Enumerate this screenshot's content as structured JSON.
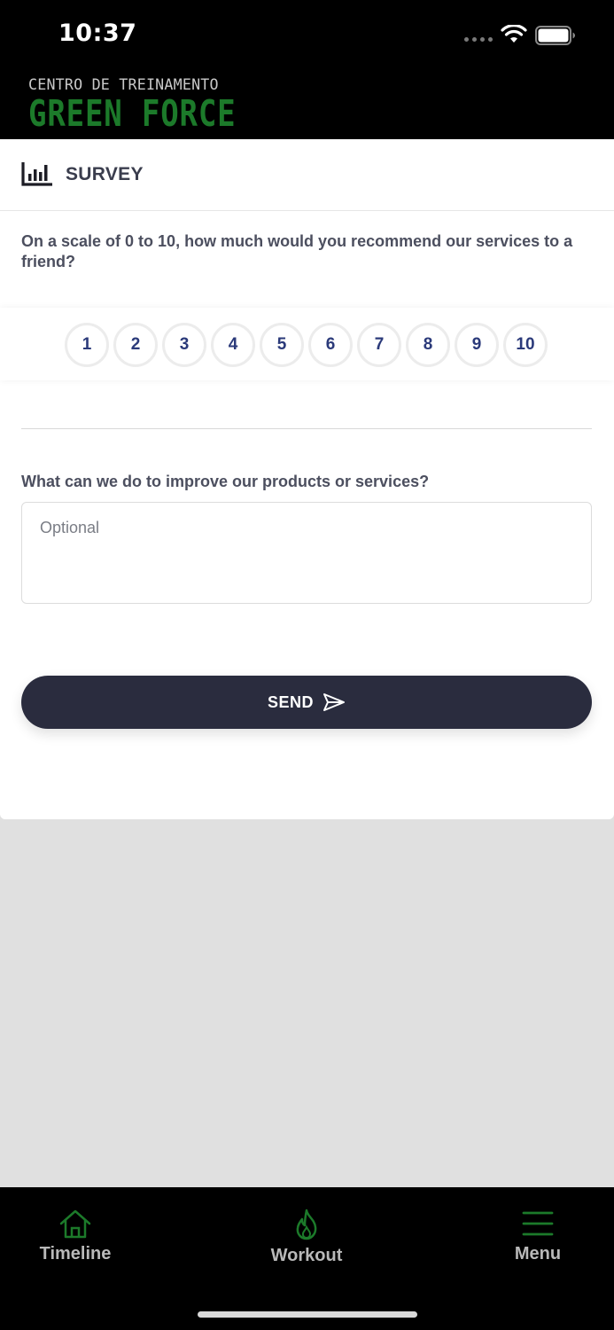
{
  "status_bar": {
    "time": "10:37"
  },
  "brand": {
    "line1": "CENTRO DE TREINAMENTO",
    "line2": "GREEN FORCE"
  },
  "survey": {
    "title": "SURVEY",
    "question_recommend": "On a scale of 0 to 10, how much would you recommend our services to a friend?",
    "scale": [
      "1",
      "2",
      "3",
      "4",
      "5",
      "6",
      "7",
      "8",
      "9",
      "10"
    ],
    "question_improve": "What can we do to improve our products or services?",
    "improve_value": "",
    "improve_placeholder": "Optional",
    "send_label": "SEND"
  },
  "nav": {
    "items": [
      {
        "label": "Timeline",
        "icon": "home-icon"
      },
      {
        "label": "Workout",
        "icon": "flame-icon"
      },
      {
        "label": "Menu",
        "icon": "menu-icon"
      }
    ]
  },
  "colors": {
    "accent_green": "#1c7a2a",
    "dark_button": "#2a2c3e",
    "scale_text": "#2b3a7a"
  }
}
